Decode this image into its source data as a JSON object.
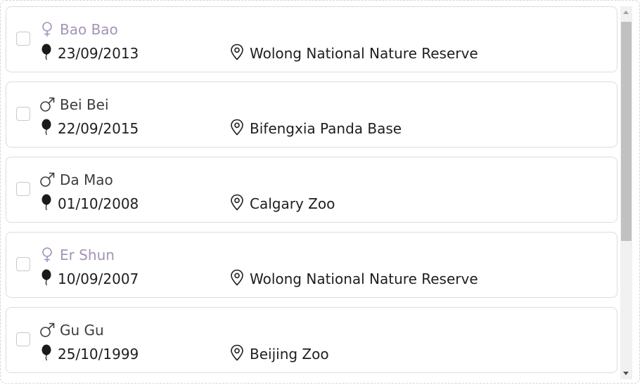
{
  "pandas": [
    {
      "name": "Bao Bao",
      "gender": "female",
      "birthdate": "23/09/2013",
      "location": "Wolong National Nature Reserve"
    },
    {
      "name": "Bei Bei",
      "gender": "male",
      "birthdate": "22/09/2015",
      "location": "Bifengxia Panda Base"
    },
    {
      "name": "Da Mao",
      "gender": "male",
      "birthdate": "01/10/2008",
      "location": "Calgary Zoo"
    },
    {
      "name": "Er Shun",
      "gender": "female",
      "birthdate": "10/09/2007",
      "location": "Wolong National Nature Reserve"
    },
    {
      "name": "Gu Gu",
      "gender": "male",
      "birthdate": "25/10/1999",
      "location": "Beijing Zoo"
    }
  ],
  "icons": {
    "female": "female-icon",
    "male": "male-icon",
    "birthday": "balloon-icon",
    "location": "map-pin-icon"
  },
  "colors": {
    "female_name": "#a493b7",
    "male_name": "#3d3d3d",
    "text": "#1e1e1e",
    "card_border": "#dcdcdc"
  }
}
